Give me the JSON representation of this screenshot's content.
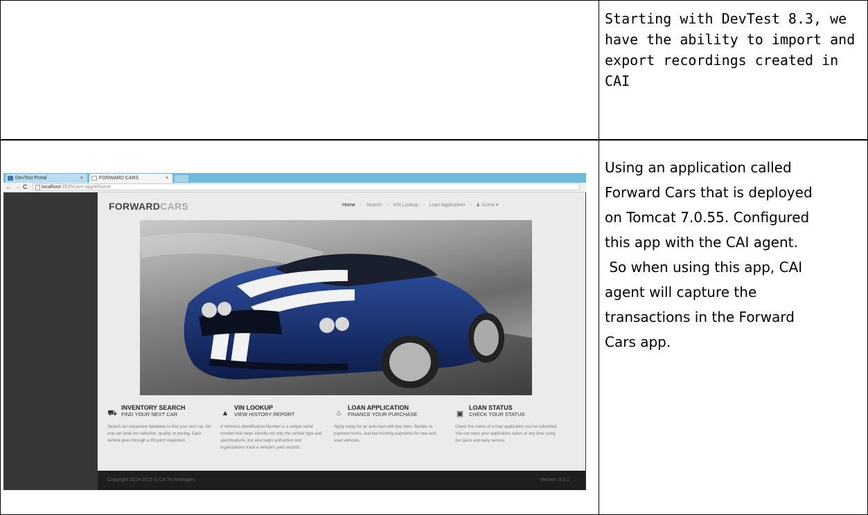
{
  "row1": {
    "note": "Starting with DevTest 8.3, we have the ability to import and export recordings created in CAI"
  },
  "row2": {
    "lines": [
      "Using an application called",
      "Forward Cars that is deployed",
      "on Tomcat 7.0.55. Configured",
      "this app with the CAI agent.",
      " So when using this app, CAI",
      "agent will capture the",
      "transactions in the Forward",
      "Cars app."
    ]
  },
  "browser": {
    "tabs": [
      {
        "label": "DevTest Portal"
      },
      {
        "label": "FORWARD CARS"
      }
    ],
    "close_glyph": "×",
    "url_host": "localhost",
    "url_rest": ":3535/cars-app/#/home"
  },
  "site": {
    "logo_main": "FORWARD",
    "logo_accent": "CARS",
    "nav": [
      "Home",
      "Search",
      "VIN Lookup",
      "Loan Application",
      "Guest ▾"
    ],
    "nav_separator": "▫",
    "features": [
      {
        "icon": "car-icon",
        "title": "INVENTORY SEARCH",
        "subtitle": "FIND YOUR NEXT CAR",
        "body": "Search our expansive database to find your next car. No one can beat our selection, quality, or pricing. Each vehicle goes through a 99 point inspection."
      },
      {
        "icon": "road-icon",
        "title": "VIN LOOKUP",
        "subtitle": "VIEW HISTORY REPORT",
        "body": "A Vehicle's Identification Number is a unique serial number that helps identify not only the vehicle type and specifications, but also helps authorities and organizations track a vehicle's past records."
      },
      {
        "icon": "bank-icon",
        "title": "LOAN APPLICATION",
        "subtitle": "FINANCE YOUR PURCHASE",
        "body": "Apply today for an auto loan with low rates, flexible re-payment terms, and low monthly payments for new and used vehicles."
      },
      {
        "icon": "money-icon",
        "title": "LOAN STATUS",
        "subtitle": "CHECK YOUR STATUS",
        "body": "Check the status of a loan application you've submitted. You can track your application status at any time using our quick and easy service."
      }
    ],
    "footer_copyright": "Copyright 2014-2015 © CA Technologies",
    "footer_version": "Version: 3.0.1"
  }
}
